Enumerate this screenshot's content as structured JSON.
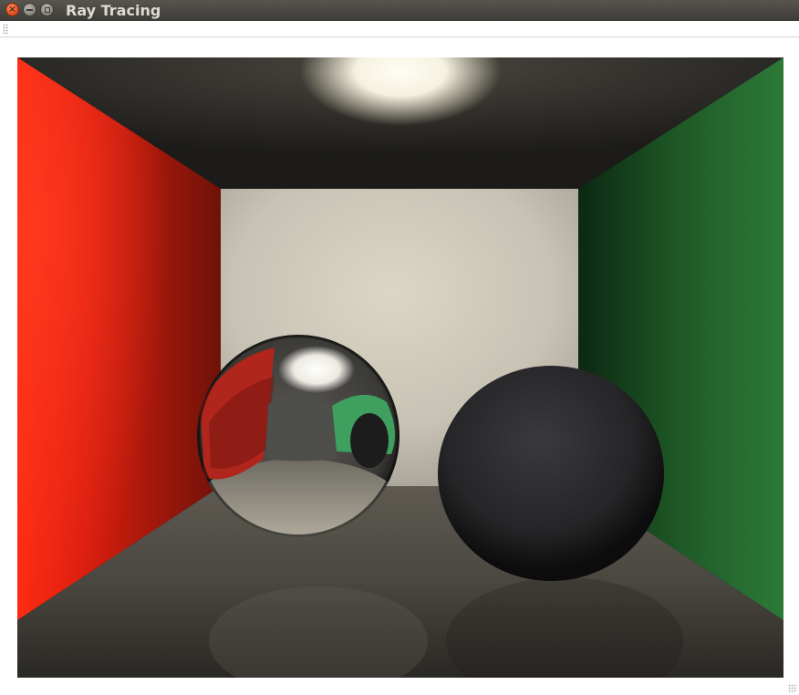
{
  "window": {
    "title": "Ray Tracing",
    "controls": {
      "close_glyph": "×",
      "close_icon": "close-icon",
      "minimize_icon": "minimize-icon",
      "maximize_icon": "maximize-icon"
    }
  },
  "scene": {
    "description_icons": [
      "red-wall",
      "green-wall",
      "white-back-wall",
      "ceiling-light",
      "mirror-sphere",
      "dark-sphere",
      "floor"
    ],
    "colors": {
      "left_wall": "#e8321a",
      "right_wall": "#2a6e35",
      "back_wall": "#d9d3c4",
      "ceiling": "#2c2a26",
      "floor": "#55514a",
      "dark_sphere": "#2b2b2d"
    }
  }
}
